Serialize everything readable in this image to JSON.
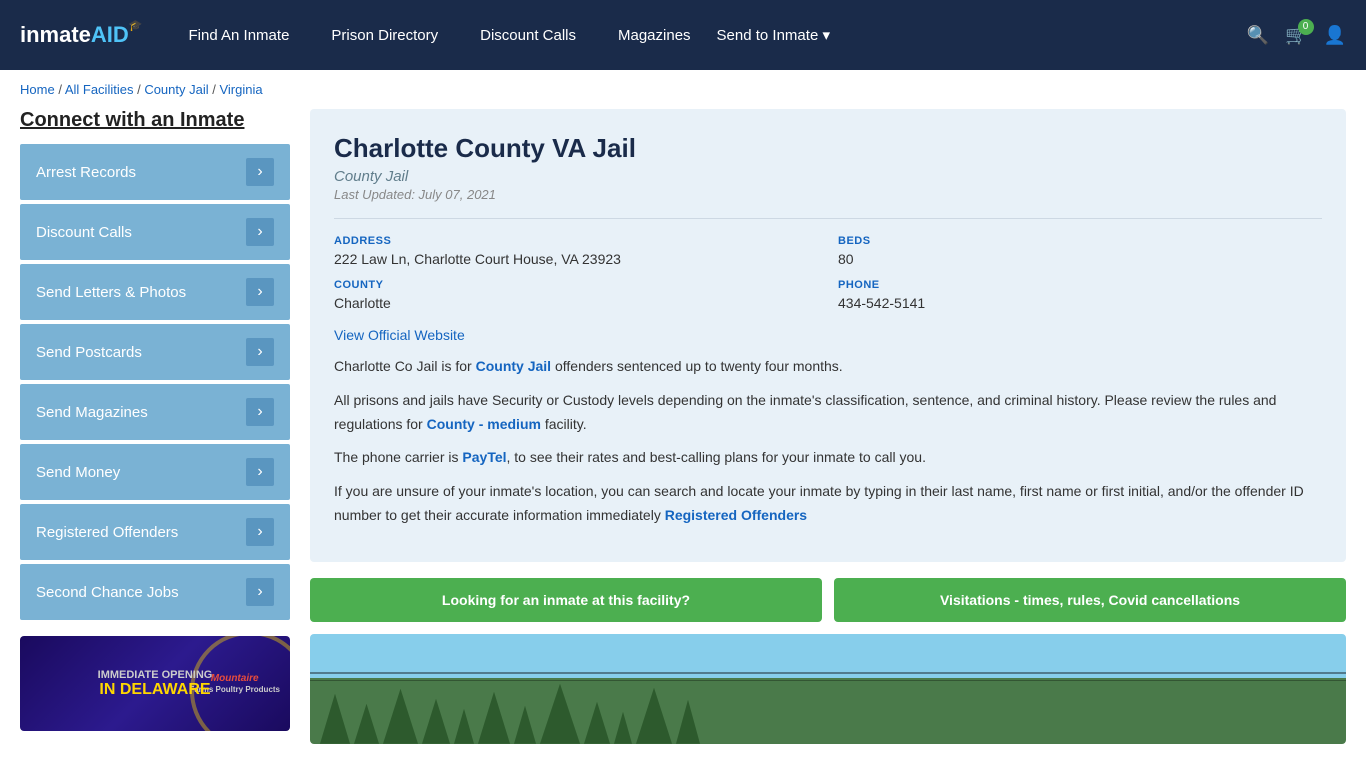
{
  "nav": {
    "logo": "inmateAID",
    "logo_icon": "🎓",
    "links": [
      {
        "label": "Find An Inmate",
        "id": "find-inmate"
      },
      {
        "label": "Prison Directory",
        "id": "prison-directory"
      },
      {
        "label": "Discount Calls",
        "id": "discount-calls"
      },
      {
        "label": "Magazines",
        "id": "magazines"
      },
      {
        "label": "Send to Inmate",
        "id": "send-to-inmate"
      }
    ],
    "cart_count": "0",
    "send_to_inmate_label": "Send to Inmate ▾"
  },
  "breadcrumb": {
    "items": [
      "Home",
      "All Facilities",
      "County Jail",
      "Virginia"
    ]
  },
  "sidebar": {
    "title": "Connect with an Inmate",
    "menu_items": [
      {
        "label": "Arrest Records",
        "id": "arrest-records"
      },
      {
        "label": "Discount Calls",
        "id": "discount-calls"
      },
      {
        "label": "Send Letters & Photos",
        "id": "send-letters"
      },
      {
        "label": "Send Postcards",
        "id": "send-postcards"
      },
      {
        "label": "Send Magazines",
        "id": "send-magazines"
      },
      {
        "label": "Send Money",
        "id": "send-money"
      },
      {
        "label": "Registered Offenders",
        "id": "registered-offenders"
      },
      {
        "label": "Second Chance Jobs",
        "id": "second-chance-jobs"
      }
    ],
    "ad": {
      "line1": "IMMEDIATE OPENING",
      "line2": "IN DELAWARE",
      "logo": "Mountaire"
    }
  },
  "facility": {
    "name": "Charlotte County VA Jail",
    "type": "County Jail",
    "last_updated": "Last Updated: July 07, 2021",
    "address_label": "ADDRESS",
    "address_value": "222 Law Ln, Charlotte Court House, VA 23923",
    "beds_label": "BEDS",
    "beds_value": "80",
    "county_label": "COUNTY",
    "county_value": "Charlotte",
    "phone_label": "PHONE",
    "phone_value": "434-542-5141",
    "official_link": "View Official Website",
    "description": [
      "Charlotte Co Jail is for County Jail offenders sentenced up to twenty four months.",
      "All prisons and jails have Security or Custody levels depending on the inmate's classification, sentence, and criminal history. Please review the rules and regulations for County - medium facility.",
      "The phone carrier is PayTel, to see their rates and best-calling plans for your inmate to call you.",
      "If you are unsure of your inmate's location, you can search and locate your inmate by typing in their last name, first name or first initial, and/or the offender ID number to get their accurate information immediately Registered Offenders"
    ]
  },
  "buttons": {
    "find_inmate": "Looking for an inmate at this facility?",
    "visitations": "Visitations - times, rules, Covid cancellations"
  }
}
